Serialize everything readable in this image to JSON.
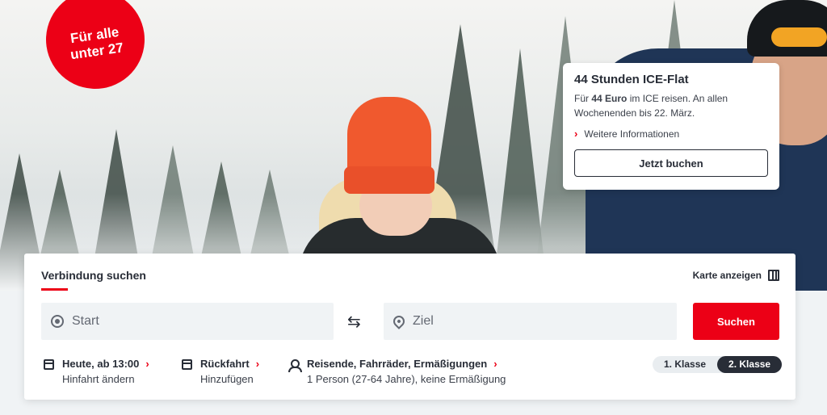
{
  "badge": {
    "text": "Für alle\nunter 27"
  },
  "promo": {
    "title": "44 Stunden ICE-Flat",
    "text_pre": "Für ",
    "text_bold": "44 Euro",
    "text_post": " im ICE reisen. An allen Wochenenden bis 22. März.",
    "link_label": "Weitere Informationen",
    "button_label": "Jetzt buchen"
  },
  "search": {
    "title": "Verbindung suchen",
    "map_label": "Karte anzeigen",
    "start_placeholder": "Start",
    "ziel_placeholder": "Ziel",
    "search_label": "Suchen",
    "swap_icon": "⇆"
  },
  "options": {
    "hinfahrt_main": "Heute, ab 13:00",
    "hinfahrt_sub": "Hinfahrt ändern",
    "rueckfahrt_main": "Rückfahrt",
    "rueckfahrt_sub": "Hinzufügen",
    "reisende_main": "Reisende, Fahrräder, Ermäßigungen",
    "reisende_sub": "1 Person (27-64 Jahre), keine Ermäßigung",
    "chevron": "›"
  },
  "klasse": {
    "first": "1. Klasse",
    "second": "2. Klasse",
    "selected": "2. Klasse"
  },
  "colors": {
    "brand_red": "#ec0016",
    "dark": "#282d37"
  }
}
